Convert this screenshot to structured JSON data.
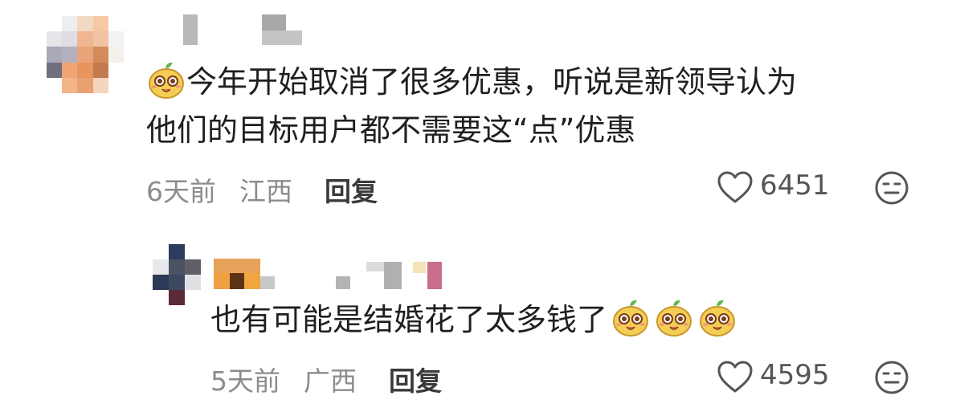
{
  "comments": [
    {
      "text_line1": "今年开始取消了很多优惠，听说是新领导认为",
      "text_line2": "他们的目标用户都不需要这“点”优惠",
      "time": "6天前",
      "location": "江西",
      "reply_label": "回复",
      "likes": "6451",
      "emoji_count": 1
    },
    {
      "text": "也有可能是结婚花了太多钱了",
      "time": "5天前",
      "location": "广西",
      "reply_label": "回复",
      "likes": "4595",
      "emoji_count": 3
    }
  ],
  "icons": {
    "like": "heart-outline-icon",
    "dislike": "neutral-face-icon",
    "emoji": "potato-grin-emoji"
  },
  "colors": {
    "text": "#1f1f1f",
    "meta": "#8c8c8c",
    "emoji_yellow": "#f4cd55",
    "emoji_leaf": "#5fb84a"
  }
}
